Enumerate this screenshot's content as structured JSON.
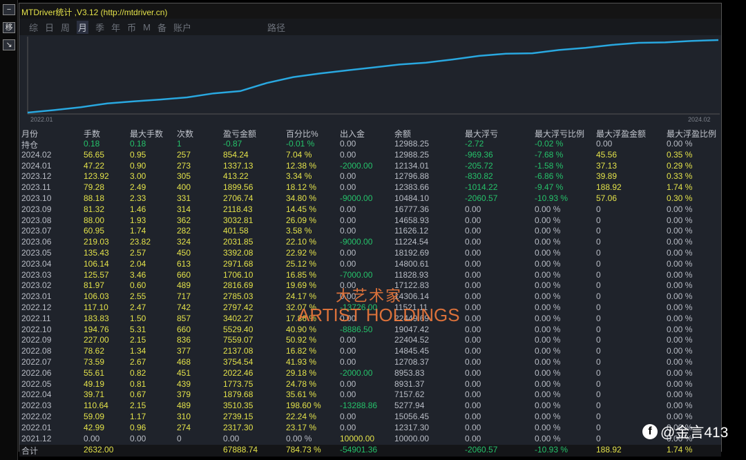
{
  "window": {
    "title": "MTDriver统计 ,V3.12 (http://mtdriver.cn)"
  },
  "leftbar": {
    "btn1": "−",
    "btn2": "移",
    "btn3": "↘"
  },
  "tabs": [
    "综",
    "日",
    "周",
    "月",
    "季",
    "年",
    "币",
    "M",
    "备",
    "账户",
    "路径"
  ],
  "active_tab": "月",
  "chart": {
    "x_start": "2022.01",
    "x_end": "2024.02",
    "line_color": "#29a8e0"
  },
  "colors": {
    "yellow": "#e3e24a",
    "green": "#25c26a",
    "gray": "#b9bdc6"
  },
  "headers": [
    "月份",
    "手数",
    "最大手数",
    "次数",
    "盈亏金额",
    "百分比%",
    "出入金",
    "余额",
    "最大浮亏",
    "最大浮亏比例",
    "最大浮盈金额",
    "最大浮盈比例"
  ],
  "rows": [
    [
      "持仓",
      "0.18",
      "0.18",
      "1",
      "-0.87",
      "-0.01 %",
      "0.00",
      "12988.25",
      "-2.72",
      "-0.02 %",
      "0.00",
      "0.00 %"
    ],
    [
      "2024.02",
      "56.65",
      "0.95",
      "257",
      "854.24",
      "7.04 %",
      "0.00",
      "12988.25",
      "-969.36",
      "-7.68 %",
      "45.56",
      "0.35 %"
    ],
    [
      "2024.01",
      "47.22",
      "0.90",
      "273",
      "1337.13",
      "12.38 %",
      "-2000.00",
      "12134.01",
      "-205.72",
      "-1.58 %",
      "37.13",
      "0.29 %"
    ],
    [
      "2023.12",
      "123.92",
      "3.00",
      "305",
      "413.22",
      "3.34 %",
      "0.00",
      "12796.88",
      "-830.82",
      "-6.86 %",
      "39.89",
      "0.33 %"
    ],
    [
      "2023.11",
      "79.28",
      "2.49",
      "400",
      "1899.56",
      "18.12 %",
      "0.00",
      "12383.66",
      "-1014.22",
      "-9.47 %",
      "188.92",
      "1.74 %"
    ],
    [
      "2023.10",
      "88.18",
      "2.33",
      "331",
      "2706.74",
      "34.80 %",
      "-9000.00",
      "10484.10",
      "-2060.57",
      "-10.93 %",
      "57.06",
      "0.30 %"
    ],
    [
      "2023.09",
      "81.32",
      "1.46",
      "314",
      "2118.43",
      "14.45 %",
      "0.00",
      "16777.36",
      "0.00",
      "0.00 %",
      "0",
      "0.00 %"
    ],
    [
      "2023.08",
      "88.00",
      "1.93",
      "362",
      "3032.81",
      "26.09 %",
      "0.00",
      "14658.93",
      "0.00",
      "0.00 %",
      "0",
      "0.00 %"
    ],
    [
      "2023.07",
      "60.95",
      "1.74",
      "282",
      "401.58",
      "3.58 %",
      "0.00",
      "11626.12",
      "0.00",
      "0.00 %",
      "0",
      "0.00 %"
    ],
    [
      "2023.06",
      "219.03",
      "23.82",
      "324",
      "2031.85",
      "22.10 %",
      "-9000.00",
      "11224.54",
      "0.00",
      "0.00 %",
      "0",
      "0.00 %"
    ],
    [
      "2023.05",
      "135.43",
      "2.57",
      "450",
      "3392.08",
      "22.92 %",
      "0.00",
      "18192.69",
      "0.00",
      "0.00 %",
      "0",
      "0.00 %"
    ],
    [
      "2023.04",
      "106.14",
      "2.04",
      "613",
      "2971.68",
      "25.12 %",
      "0.00",
      "14800.61",
      "0.00",
      "0.00 %",
      "0",
      "0.00 %"
    ],
    [
      "2023.03",
      "125.57",
      "3.46",
      "660",
      "1706.10",
      "16.85 %",
      "-7000.00",
      "11828.93",
      "0.00",
      "0.00 %",
      "0",
      "0.00 %"
    ],
    [
      "2023.02",
      "81.97",
      "0.60",
      "489",
      "2816.69",
      "19.69 %",
      "0.00",
      "17122.83",
      "0.00",
      "0.00 %",
      "0",
      "0.00 %"
    ],
    [
      "2023.01",
      "106.03",
      "2.55",
      "717",
      "2785.03",
      "24.17 %",
      "0.00",
      "14306.14",
      "0.00",
      "0.00 %",
      "0",
      "0.00 %"
    ],
    [
      "2022.12",
      "117.10",
      "2.47",
      "742",
      "2797.42",
      "32.07 %",
      "-13726.00",
      "11521.11",
      "0.00",
      "0.00 %",
      "0",
      "0.00 %"
    ],
    [
      "2022.11",
      "183.83",
      "1.50",
      "857",
      "3402.27",
      "17.86 %",
      "0.00",
      "22449.69",
      "0.00",
      "0.00 %",
      "0",
      "0.00 %"
    ],
    [
      "2022.10",
      "194.76",
      "5.31",
      "660",
      "5529.40",
      "40.90 %",
      "-8886.50",
      "19047.42",
      "0.00",
      "0.00 %",
      "0",
      "0.00 %"
    ],
    [
      "2022.09",
      "227.00",
      "2.15",
      "836",
      "7559.07",
      "50.92 %",
      "0.00",
      "22404.52",
      "0.00",
      "0.00 %",
      "0",
      "0.00 %"
    ],
    [
      "2022.08",
      "78.62",
      "1.34",
      "377",
      "2137.08",
      "16.82 %",
      "0.00",
      "14845.45",
      "0.00",
      "0.00 %",
      "0",
      "0.00 %"
    ],
    [
      "2022.07",
      "73.59",
      "2.67",
      "468",
      "3754.54",
      "41.93 %",
      "0.00",
      "12708.37",
      "0.00",
      "0.00 %",
      "0",
      "0.00 %"
    ],
    [
      "2022.06",
      "55.61",
      "0.82",
      "451",
      "2022.46",
      "29.18 %",
      "-2000.00",
      "8953.83",
      "0.00",
      "0.00 %",
      "0",
      "0.00 %"
    ],
    [
      "2022.05",
      "49.19",
      "0.81",
      "439",
      "1773.75",
      "24.78 %",
      "0.00",
      "8931.37",
      "0.00",
      "0.00 %",
      "0",
      "0.00 %"
    ],
    [
      "2022.04",
      "39.71",
      "0.67",
      "379",
      "1879.68",
      "35.61 %",
      "0.00",
      "7157.62",
      "0.00",
      "0.00 %",
      "0",
      "0.00 %"
    ],
    [
      "2022.03",
      "110.64",
      "2.15",
      "489",
      "3510.35",
      "198.60 %",
      "-13288.86",
      "5277.94",
      "0.00",
      "0.00 %",
      "0",
      "0.00 %"
    ],
    [
      "2022.02",
      "59.09",
      "1.17",
      "310",
      "2739.15",
      "22.24 %",
      "0.00",
      "15056.45",
      "0.00",
      "0.00 %",
      "0",
      "0.00 %"
    ],
    [
      "2022.01",
      "42.99",
      "0.96",
      "274",
      "2317.30",
      "23.17 %",
      "0.00",
      "12317.30",
      "0.00",
      "0.00 %",
      "0",
      "0.00 %"
    ],
    [
      "2021.12",
      "0.00",
      "0.00",
      "0",
      "0.00",
      "0.00 %",
      "10000.00",
      "10000.00",
      "0.00",
      "0.00 %",
      "0",
      "0.00 %"
    ]
  ],
  "total": [
    "合计",
    "2632.00",
    "",
    "",
    "67888.74",
    "784.73 %",
    "-54901.36",
    "",
    "-2060.57",
    "-10.93 %",
    "188.92",
    "1.74 %"
  ],
  "watermark": {
    "cn": "大艺术家",
    "en": "ARTIST HOLDINGS"
  },
  "social": {
    "handle": "@金言413",
    "icon": "facebook-icon"
  }
}
